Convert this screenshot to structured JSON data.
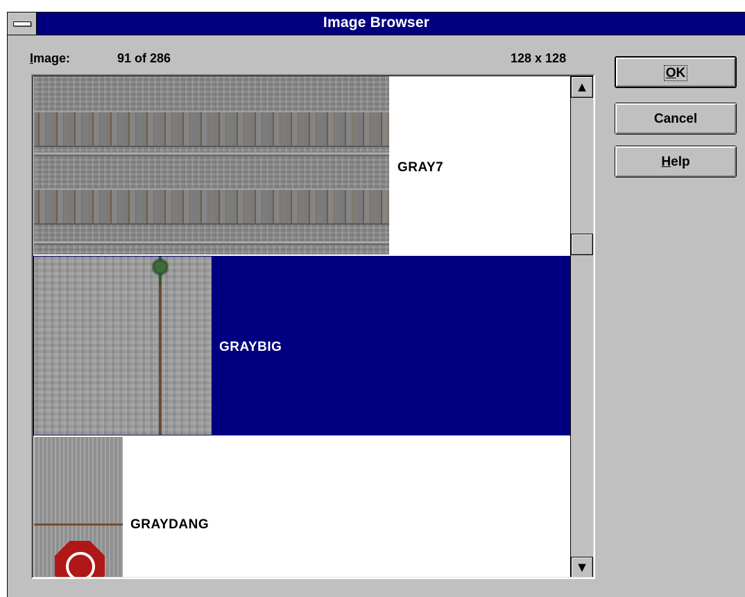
{
  "window": {
    "title": "Image Browser"
  },
  "info": {
    "image_label_prefix": "I",
    "image_label_rest": "mage:",
    "count": "91 of 286",
    "size": "128 x 128"
  },
  "list": {
    "items": [
      {
        "name": "GRAY7",
        "selected": false
      },
      {
        "name": "GRAYBIG",
        "selected": true
      },
      {
        "name": "GRAYDANG",
        "selected": false
      }
    ]
  },
  "buttons": {
    "ok_prefix": "O",
    "ok_rest": "K",
    "cancel": "Cancel",
    "help_prefix": "H",
    "help_rest": "elp"
  },
  "scrollbar": {
    "up_icon": "arrow-up-icon",
    "down_icon": "arrow-down-icon"
  },
  "colors": {
    "title_bar": "#000080",
    "selection": "#000080",
    "face": "#c0c0c0"
  }
}
